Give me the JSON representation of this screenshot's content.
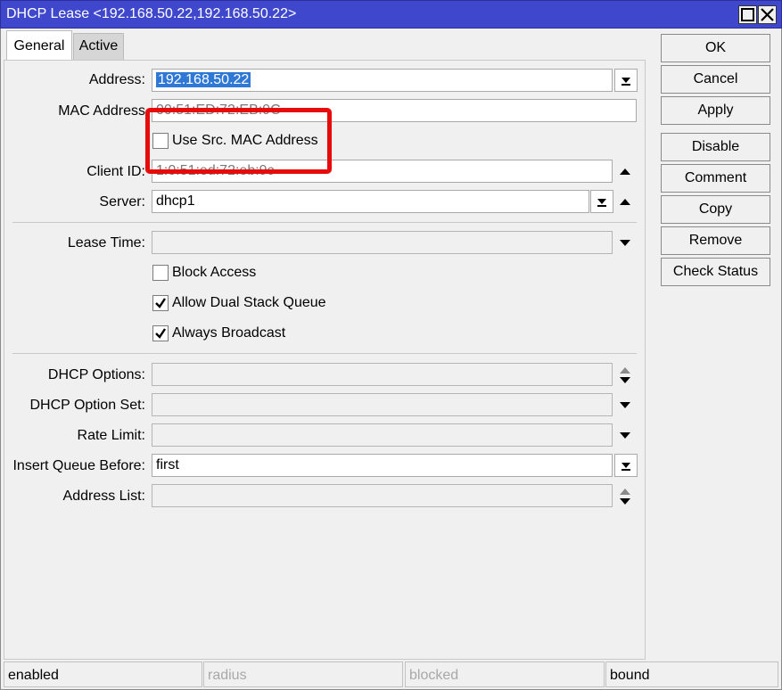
{
  "window": {
    "title": "DHCP Lease <192.168.50.22,192.168.50.22>",
    "title_bar_color": "#3f48cc"
  },
  "tabs": [
    {
      "label": "General"
    },
    {
      "label": "Active"
    }
  ],
  "fields": {
    "address": {
      "label": "Address:",
      "value": "192.168.50.22"
    },
    "mac_address": {
      "label": "MAC Address",
      "value": "00:51:ED:72:EB:9C"
    },
    "use_src_mac": {
      "label": "Use Src. MAC Address",
      "checked": false
    },
    "client_id": {
      "label": "Client ID:",
      "value": "1:0:51:ed:72:eb:9c"
    },
    "server": {
      "label": "Server:",
      "value": "dhcp1"
    },
    "lease_time": {
      "label": "Lease Time:",
      "value": ""
    },
    "block_access": {
      "label": "Block Access",
      "checked": false
    },
    "allow_dual_stack_queue": {
      "label": "Allow Dual Stack Queue",
      "checked": true
    },
    "always_broadcast": {
      "label": "Always Broadcast",
      "checked": true
    },
    "dhcp_options": {
      "label": "DHCP Options:",
      "value": ""
    },
    "dhcp_option_set": {
      "label": "DHCP Option Set:",
      "value": ""
    },
    "rate_limit": {
      "label": "Rate Limit:",
      "value": ""
    },
    "insert_queue_before": {
      "label": "Insert Queue Before:",
      "value": "first"
    },
    "address_list": {
      "label": "Address List:",
      "value": ""
    }
  },
  "buttons": {
    "ok": "OK",
    "cancel": "Cancel",
    "apply": "Apply",
    "disable": "Disable",
    "comment": "Comment",
    "copy": "Copy",
    "remove": "Remove",
    "check_status": "Check Status"
  },
  "status_bar": {
    "enabled": "enabled",
    "radius": "radius",
    "blocked": "blocked",
    "bound": "bound"
  },
  "highlight_color": "#e80b0b"
}
